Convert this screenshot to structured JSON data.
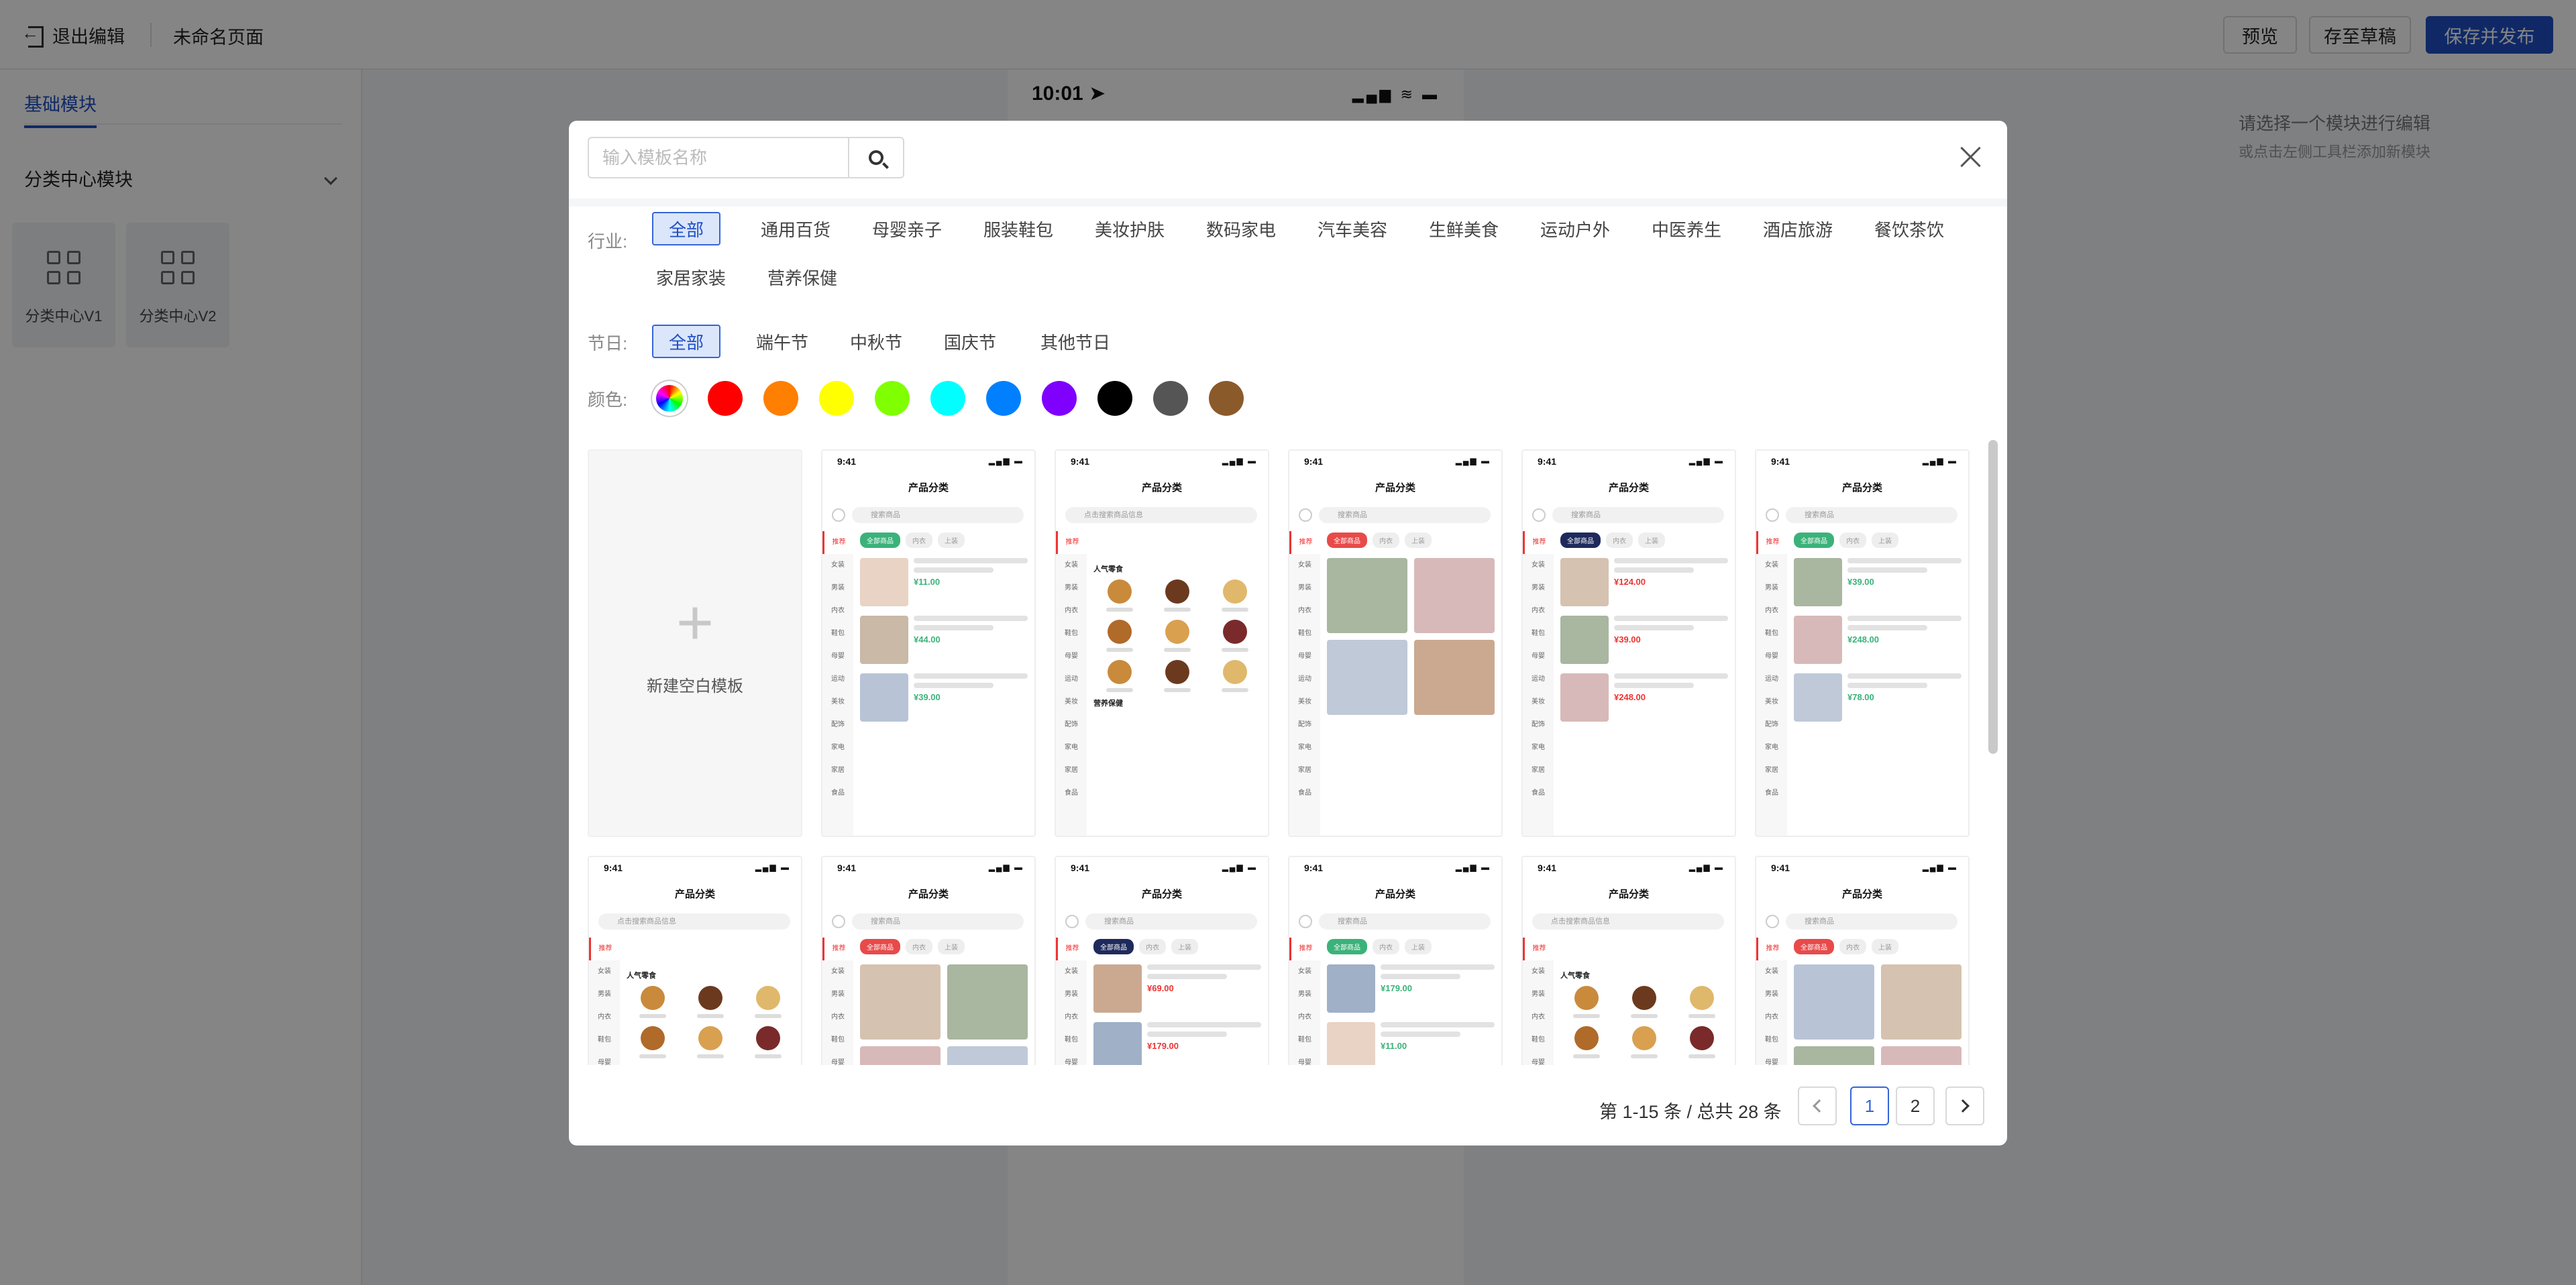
{
  "topbar": {
    "exit_label": "退出编辑",
    "page_name": "未命名页面",
    "preview_label": "预览",
    "draft_label": "存至草稿",
    "publish_label": "保存并发布"
  },
  "leftpanel": {
    "tab": "基础模块",
    "section": "分类中心模块",
    "modules": [
      "分类中心V1",
      "分类中心V2"
    ]
  },
  "phone": {
    "time": "10:01",
    "status": "▂▄▆ ≋ ▬"
  },
  "right_hint": {
    "line1": "请选择一个模块进行编辑",
    "line2": "或点击左侧工具栏添加新模块"
  },
  "modal": {
    "search": {
      "placeholder": "输入模板名称",
      "value": ""
    },
    "industry": {
      "label": "行业:",
      "options": [
        "全部",
        "通用百货",
        "母婴亲子",
        "服装鞋包",
        "美妆护肤",
        "数码家电",
        "汽车美容",
        "生鲜美食",
        "运动户外",
        "中医养生",
        "酒店旅游",
        "餐饮茶饮",
        "家居家装",
        "营养保健"
      ],
      "selected": "全部"
    },
    "festival": {
      "label": "节日:",
      "options": [
        "全部",
        "端午节",
        "中秋节",
        "国庆节",
        "其他节日"
      ],
      "selected": "全部"
    },
    "color": {
      "label": "颜色:",
      "swatches": [
        "rainbow",
        "#ff0000",
        "#ff7f00",
        "#ffff00",
        "#80ff00",
        "#00ffff",
        "#0080ff",
        "#8000ff",
        "#000000",
        "#555555",
        "#8b5a2b"
      ]
    },
    "blank_template_label": "新建空白模板",
    "template_mock": {
      "time": "9:41",
      "signal": "▂▄▆ ▬",
      "title": "产品分类",
      "search_placeholder": "搜索商品",
      "search_placeholder_alt": "点击搜索商品信息",
      "side": [
        "推荐",
        "女装",
        "男装",
        "内衣",
        "鞋包",
        "母婴",
        "运动",
        "美妆",
        "配饰",
        "家电",
        "家居",
        "食品"
      ],
      "pills": [
        "全部商品",
        "内衣",
        "上装"
      ],
      "section1": "人气零食",
      "section2": "营养保健",
      "prices": [
        "¥11.00",
        "¥44.00",
        "¥39.00",
        "¥124.00",
        "¥39.00",
        "¥248.00",
        "¥78.00",
        "¥69.00",
        "¥179.00"
      ]
    },
    "pagination": {
      "info": "第 1-15 条 / 总共 28 条",
      "pages": [
        "1",
        "2"
      ],
      "current": "1"
    }
  }
}
